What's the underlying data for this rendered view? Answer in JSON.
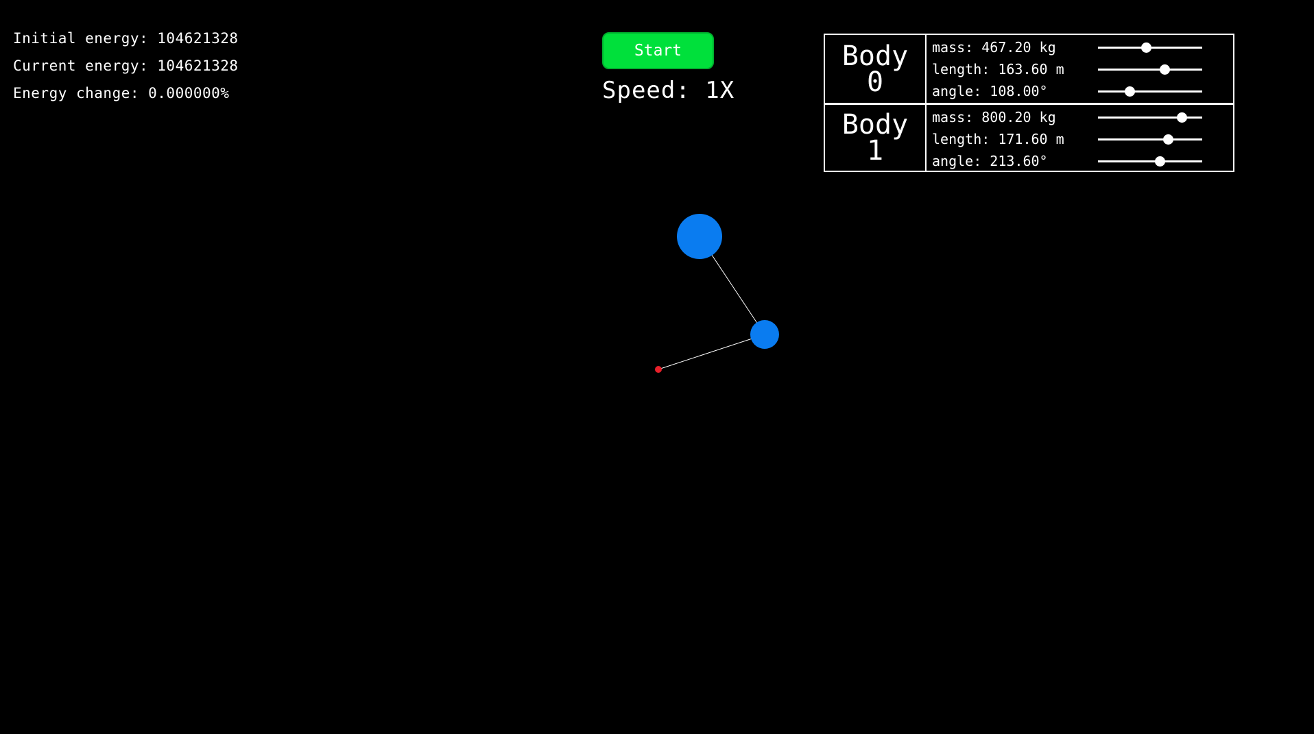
{
  "energy": {
    "initial": "Initial energy: 104621328",
    "current": "Current energy: 104621328",
    "change": "Energy change: 0.000000%"
  },
  "controls": {
    "start_label": "Start",
    "speed_label": "Speed: 1X"
  },
  "bodies": [
    {
      "name_line1": "Body",
      "name_line2": "0",
      "mass": {
        "label": "mass: 467.20 kg",
        "fraction": 0.46
      },
      "length": {
        "label": "length: 163.60 m",
        "fraction": 0.64
      },
      "angle": {
        "label": "angle: 108.00°",
        "fraction": 0.3
      }
    },
    {
      "name_line1": "Body",
      "name_line2": "1",
      "mass": {
        "label": "mass: 800.20 kg",
        "fraction": 0.8
      },
      "length": {
        "label": "length: 171.60 m",
        "fraction": 0.67
      },
      "angle": {
        "label": "angle: 213.60°",
        "fraction": 0.59
      }
    }
  ],
  "colors": {
    "background": "#000000",
    "start_button": "#00e03b",
    "body": "#0a7cf0",
    "tip": "#e8202a",
    "rod": "#ffffff"
  }
}
